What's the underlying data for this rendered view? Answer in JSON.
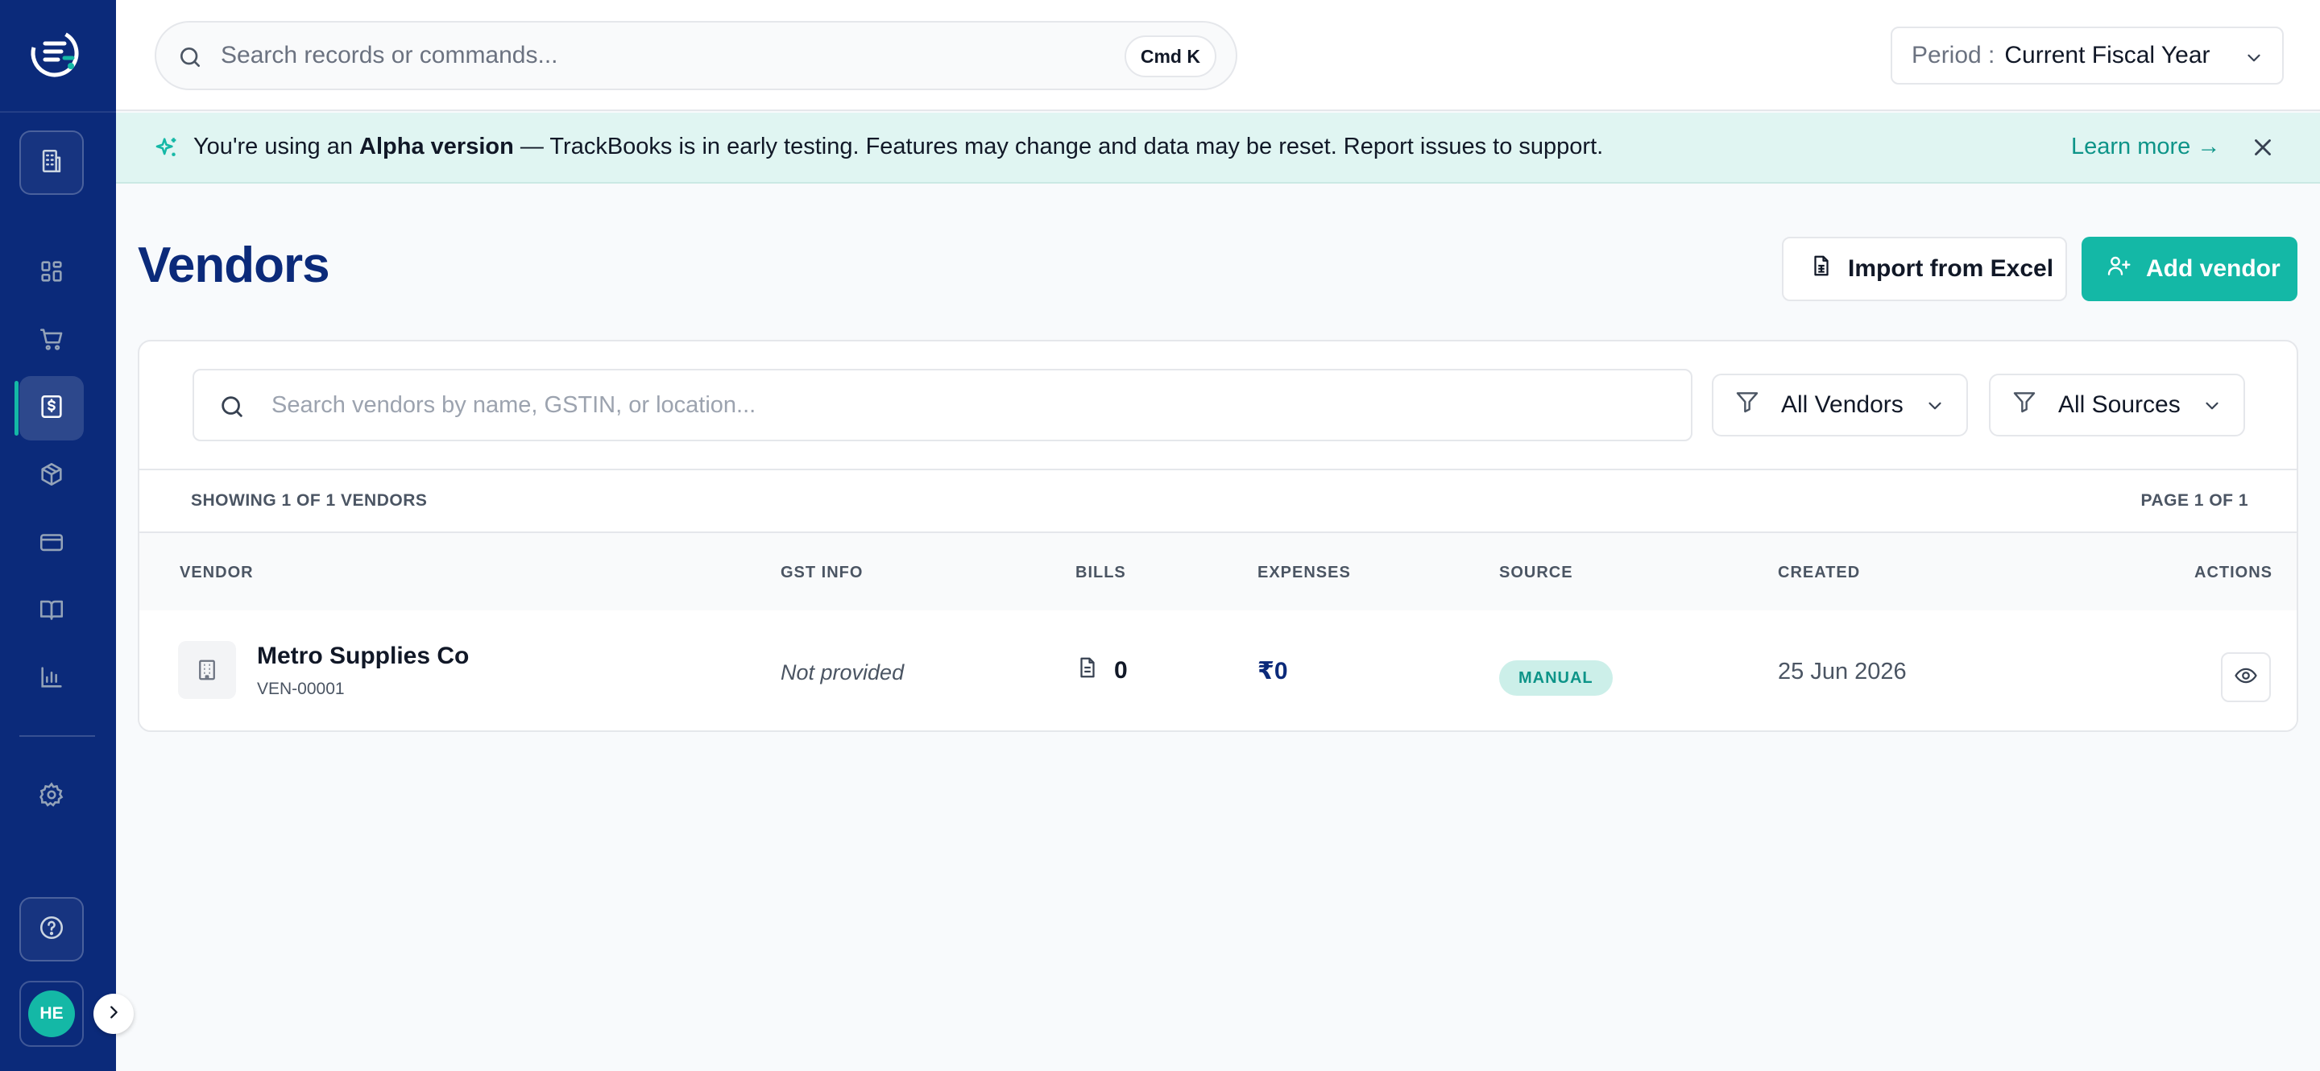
{
  "sidebar": {
    "logo_icon": "trackbooks-logo-icon",
    "org_button_icon": "building-icon",
    "nav_items": [
      {
        "icon": "dashboard-grid-icon",
        "active": false
      },
      {
        "icon": "shopping-cart-icon",
        "active": false
      },
      {
        "icon": "receipt-dollar-icon",
        "active": true
      },
      {
        "icon": "package-box-icon",
        "active": false
      },
      {
        "icon": "credit-card-icon",
        "active": false
      },
      {
        "icon": "book-open-icon",
        "active": false
      },
      {
        "icon": "bar-chart-icon",
        "active": false
      }
    ],
    "settings_icon": "gear-icon",
    "help_icon": "help-circle-icon",
    "avatar_initials": "HE",
    "expand_icon": "chevron-right-icon"
  },
  "topbar": {
    "search_placeholder": "Search records or commands...",
    "shortcut": "Cmd K",
    "period_label": "Period :",
    "period_value": "Current Fiscal Year"
  },
  "banner": {
    "prefix": "You're using an ",
    "highlight": "Alpha version",
    "suffix": " — TrackBooks is in early testing. Features may change and data may be reset. Report issues to support.",
    "link": "Learn more →"
  },
  "page": {
    "title": "Vendors",
    "import_label": "Import from Excel",
    "add_label": "Add vendor"
  },
  "filters": {
    "search_placeholder": "Search vendors by name, GSTIN, or location...",
    "vendor_filter": "All Vendors",
    "source_filter": "All Sources"
  },
  "summary": {
    "showing": "SHOWING 1 OF 1 VENDORS",
    "page": "PAGE 1 OF 1"
  },
  "table": {
    "columns": [
      "VENDOR",
      "GST INFO",
      "BILLS",
      "EXPENSES",
      "SOURCE",
      "CREATED",
      "ACTIONS"
    ],
    "rows": [
      {
        "name": "Metro Supplies Co",
        "code": "VEN-00001",
        "gst": "Not provided",
        "bills": "0",
        "expenses": "₹0",
        "source": "MANUAL",
        "created": "25 Jun 2026"
      }
    ]
  },
  "colors": {
    "sidebar": "#0b2a7a",
    "accent": "#14b8a6",
    "banner_bg": "#e0f5f2",
    "title": "#0b2a7a"
  }
}
